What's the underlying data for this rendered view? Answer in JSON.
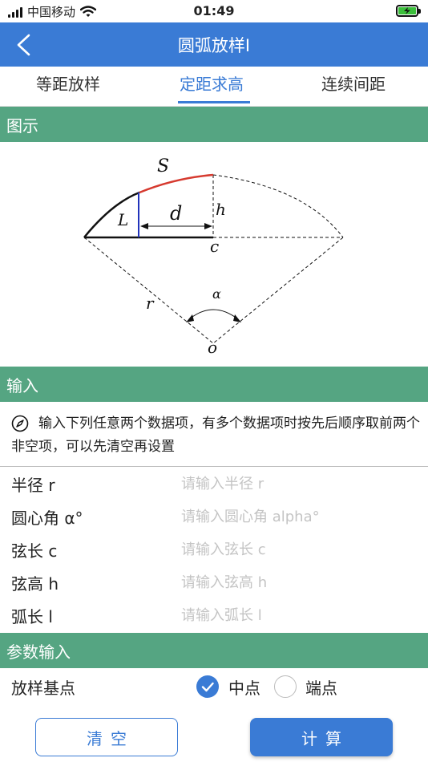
{
  "status_bar": {
    "carrier": "中国移动",
    "time": "01:49"
  },
  "nav": {
    "title": "圆弧放样I"
  },
  "tabs": [
    {
      "label": "等距放样",
      "active": false
    },
    {
      "label": "定距求高",
      "active": true
    },
    {
      "label": "连续间距",
      "active": false
    }
  ],
  "sections": {
    "diagram": "图示",
    "input": "输入",
    "params": "参数输入"
  },
  "diagram_labels": {
    "S": "S",
    "L": "L",
    "d": "d",
    "h": "h",
    "c": "c",
    "alpha": "α",
    "r": "r",
    "o": "o"
  },
  "hint": "输入下列任意两个数据项，有多个数据项时按先后顺序取前两个非空项，可以先清空再设置",
  "fields": [
    {
      "label": "半径 r",
      "placeholder": "请输入半径 r",
      "value": ""
    },
    {
      "label": "圆心角 α°",
      "placeholder": "请输入圆心角 alpha°",
      "value": ""
    },
    {
      "label": "弦长 c",
      "placeholder": "请输入弦长 c",
      "value": ""
    },
    {
      "label": "弦高 h",
      "placeholder": "请输入弦高 h",
      "value": ""
    },
    {
      "label": "弧长 l",
      "placeholder": "请输入弧长 l",
      "value": ""
    }
  ],
  "base_point": {
    "label": "放样基点",
    "options": [
      {
        "label": "中点",
        "selected": true
      },
      {
        "label": "端点",
        "selected": false
      }
    ]
  },
  "buttons": {
    "clear": "清空",
    "calculate": "计算"
  },
  "colors": {
    "primary": "#3a7bd5",
    "section": "#55a582",
    "arc_highlight": "#d63a2f"
  }
}
